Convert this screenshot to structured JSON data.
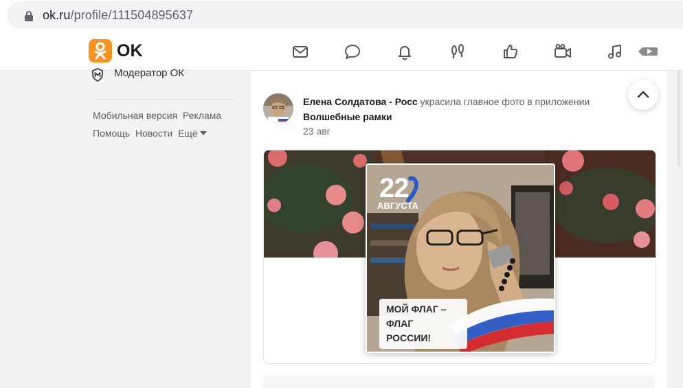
{
  "browser": {
    "url_host": "ok.ru",
    "url_path": "/profile/111504895637"
  },
  "header": {
    "logo_text": "OK",
    "accent_color": "#ee8208",
    "nav_icons": [
      "messages-icon",
      "discussions-icon",
      "notifications-icon",
      "guests-icon",
      "marks-icon",
      "video-calls-icon",
      "music-icon",
      "video-icon"
    ]
  },
  "sidebar": {
    "moderator_label": "Модератор ОК",
    "footer_links": {
      "mobile": "Мобильная версия",
      "ads": "Реклама",
      "help": "Помощь",
      "news": "Новости",
      "more": "Ещё"
    }
  },
  "feed": {
    "post": {
      "author": "Елена Солдатова - Росс",
      "action": "украсила главное фото в приложении",
      "app_name": "Волшебные рамки",
      "date": "23 авг",
      "photo": {
        "date_number": "22",
        "date_month": "АВГУСТА",
        "badge_line1": "МОЙ ФЛАГ –",
        "badge_line2": "ФЛАГ РОССИИ!"
      }
    }
  }
}
